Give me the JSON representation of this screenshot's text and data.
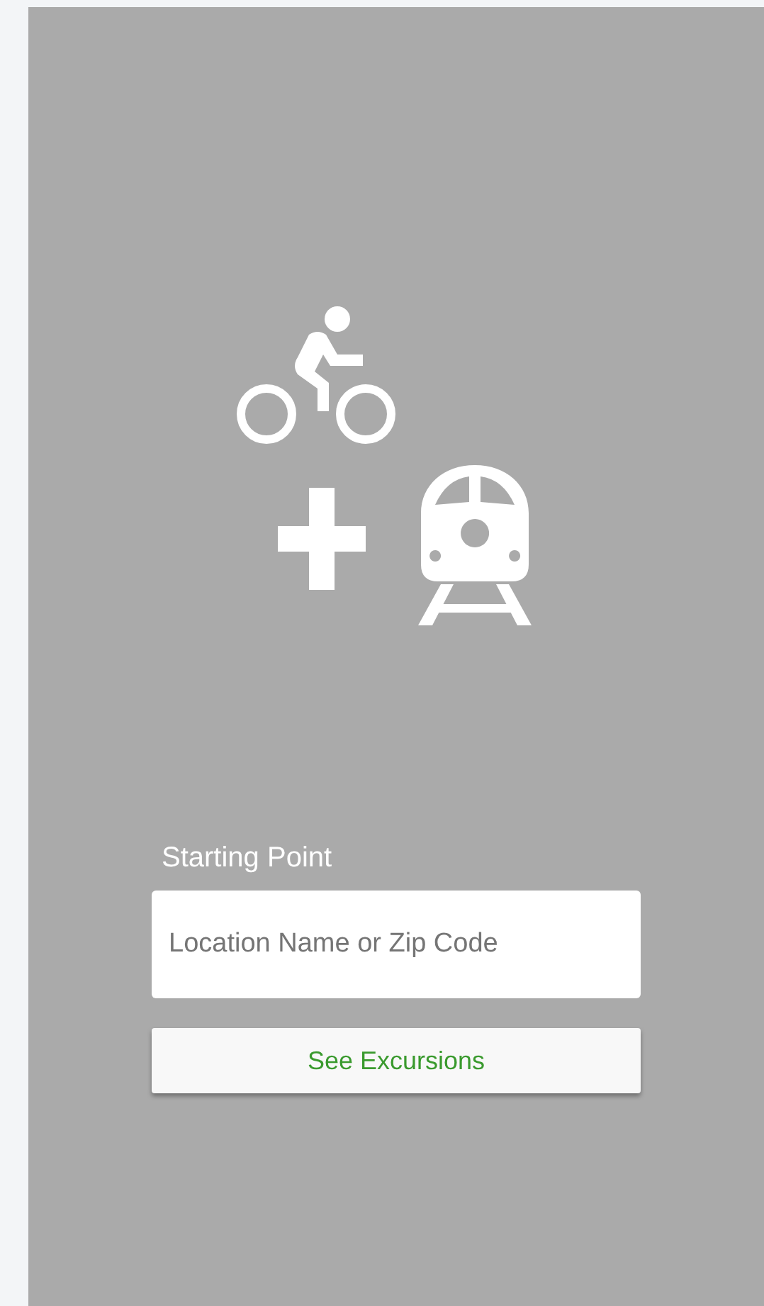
{
  "form": {
    "label": "Starting Point",
    "location_field": {
      "placeholder": "Location Name or Zip Code"
    },
    "submit_button": {
      "label": "See Excursions"
    }
  }
}
